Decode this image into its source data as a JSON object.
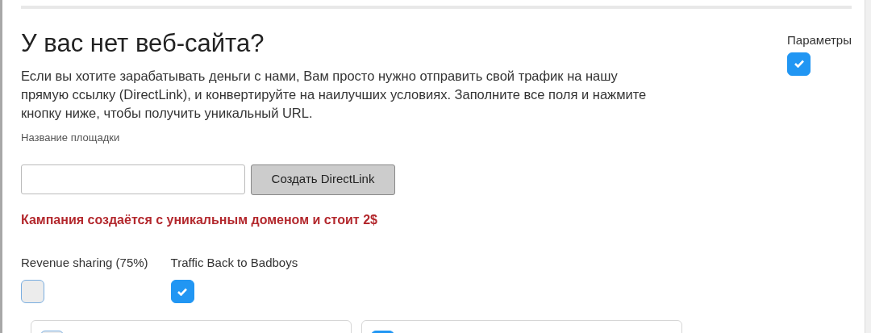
{
  "heading": "У вас нет веб-сайта?",
  "description": "Если вы хотите зарабатывать деньги с нами, Вам просто нужно отправить свой трафик на нашу прямую ссылку (DirectLink), и конвертируйте на наилучших условиях. Заполните все поля и нажмите кнопку ниже, чтобы получить уникальный URL.",
  "parameters": {
    "label": "Параметры",
    "checked": true
  },
  "site_name": {
    "label": "Название площадки"
  },
  "create_button": "Создать DirectLink",
  "notice": "Кампания создаётся с уникальным доменом и стоит 2$",
  "options": [
    {
      "label": "Revenue sharing (75%)",
      "checked": false
    },
    {
      "label": "Traffic Back to Badboys",
      "checked": true
    }
  ],
  "cards": [
    {
      "checked": false
    },
    {
      "checked": true
    }
  ]
}
